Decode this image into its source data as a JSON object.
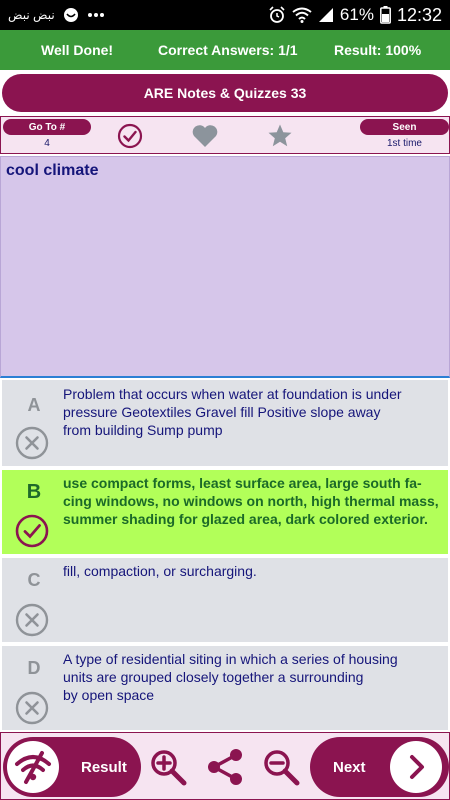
{
  "status_bar": {
    "notification_text": "نبض نبض",
    "battery": "61%",
    "time": "12:32"
  },
  "result_strip": {
    "message": "Well Done!",
    "correct_answers": "Correct Answers: 1/1",
    "result": "Result: 100%"
  },
  "title": "ARE Notes & Quizzes 33",
  "toolbar": {
    "goto_label": "Go To #",
    "goto_value": "4",
    "seen_label": "Seen",
    "seen_value": "1st time"
  },
  "question": {
    "text": "cool climate"
  },
  "answers": [
    {
      "letter": "A",
      "lines": [
        "Problem that occurs when water at foundation is under",
        "pressure Geotextiles Gravel fill Positive slope away",
        "from building Sump pump"
      ],
      "state": "wrong"
    },
    {
      "letter": "B",
      "lines": [
        "use compact forms, least surface area, large south fa-",
        "cing windows, no windows on north, high thermal mass,",
        "summer shading for glazed area, dark colored exterior."
      ],
      "state": "correct"
    },
    {
      "letter": "C",
      "lines": [
        "fill, compaction, or surcharging."
      ],
      "state": "wrong"
    },
    {
      "letter": "D",
      "lines": [
        "A type of residential siting in which a series of housing",
        "units are grouped closely together a surrounding",
        "by open space"
      ],
      "state": "wrong"
    }
  ],
  "bottom_bar": {
    "result_label": "Result",
    "next_label": "Next"
  },
  "colors": {
    "primary": "#8b1450",
    "success_strip": "#3b9a3a",
    "correct_answer": "#b2ff59",
    "question_bg": "#d6c6ea",
    "answer_bg": "#dfe1e6",
    "text_navy": "#15157a"
  },
  "icons": {
    "status_left": [
      "crescent-icon",
      "dots-icon"
    ],
    "status_right": [
      "alarm-icon",
      "wifi-icon",
      "signal-icon",
      "battery-icon"
    ],
    "toolbar": [
      "check-circle-icon",
      "heart-icon",
      "star-icon"
    ],
    "answer_marks": [
      "x-circle-icon",
      "check-circle-icon"
    ],
    "bottom": [
      "no-wifi-icon",
      "zoom-in-icon",
      "share-icon",
      "zoom-out-icon",
      "chevron-right-icon"
    ]
  }
}
